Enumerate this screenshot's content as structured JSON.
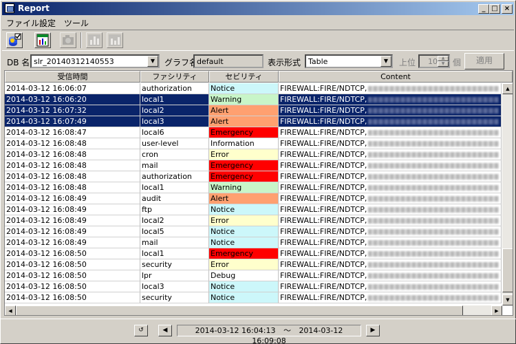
{
  "window": {
    "title": "Report"
  },
  "menu": {
    "file": "ファイル",
    "settings": "設定",
    "tools": "ツール"
  },
  "toolbar": {
    "icons": [
      "db-select-icon",
      "report-icon",
      "camera-icon",
      "bar-chart-icon",
      "chart-icon"
    ]
  },
  "options": {
    "db_label": "DB 名",
    "db_value": "slr_20140312140553",
    "graph_label": "グラフ名",
    "graph_value": "default",
    "display_label": "表示形式",
    "display_value": "Table",
    "top_label": "上位",
    "top_value": "10",
    "top_unit": "個",
    "apply_label": "適用"
  },
  "grid": {
    "headers": [
      "受信時間",
      "ファシリティ",
      "セビリティ",
      "Content"
    ],
    "rows": [
      {
        "time": "2014-03-12 16:06:07",
        "facility": "authorization",
        "severity": "Notice",
        "content": "FIREWALL:FIRE/NDTCP,",
        "selected": false
      },
      {
        "time": "2014-03-12 16:06:20",
        "facility": "local1",
        "severity": "Warning",
        "content": "FIREWALL:FIRE/NDTCP,",
        "selected": true
      },
      {
        "time": "2014-03-12 16:07:32",
        "facility": "local2",
        "severity": "Alert",
        "content": "FIREWALL:FIRE/NDTCP,",
        "selected": true
      },
      {
        "time": "2014-03-12 16:07:49",
        "facility": "local3",
        "severity": "Alert",
        "content": "FIREWALL:FIRE/NDTCP,",
        "selected": true
      },
      {
        "time": "2014-03-12 16:08:47",
        "facility": "local6",
        "severity": "Emergency",
        "content": "FIREWALL:FIRE/NDTCP,",
        "selected": false
      },
      {
        "time": "2014-03-12 16:08:48",
        "facility": "user-level",
        "severity": "Information",
        "content": "FIREWALL:FIRE/NDTCP,",
        "selected": false
      },
      {
        "time": "2014-03-12 16:08:48",
        "facility": "cron",
        "severity": "Error",
        "content": "FIREWALL:FIRE/NDTCP,",
        "selected": false
      },
      {
        "time": "2014-03-12 16:08:48",
        "facility": "mail",
        "severity": "Emergency",
        "content": "FIREWALL:FIRE/NDTCP,",
        "selected": false
      },
      {
        "time": "2014-03-12 16:08:48",
        "facility": "authorization",
        "severity": "Emergency",
        "content": "FIREWALL:FIRE/NDTCP,",
        "selected": false
      },
      {
        "time": "2014-03-12 16:08:48",
        "facility": "local1",
        "severity": "Warning",
        "content": "FIREWALL:FIRE/NDTCP,",
        "selected": false
      },
      {
        "time": "2014-03-12 16:08:49",
        "facility": "audit",
        "severity": "Alert",
        "content": "FIREWALL:FIRE/NDTCP,",
        "selected": false
      },
      {
        "time": "2014-03-12 16:08:49",
        "facility": "ftp",
        "severity": "Notice",
        "content": "FIREWALL:FIRE/NDTCP,",
        "selected": false
      },
      {
        "time": "2014-03-12 16:08:49",
        "facility": "local2",
        "severity": "Error",
        "content": "FIREWALL:FIRE/NDTCP,",
        "selected": false
      },
      {
        "time": "2014-03-12 16:08:49",
        "facility": "local5",
        "severity": "Notice",
        "content": "FIREWALL:FIRE/NDTCP,",
        "selected": false
      },
      {
        "time": "2014-03-12 16:08:49",
        "facility": "mail",
        "severity": "Notice",
        "content": "FIREWALL:FIRE/NDTCP,",
        "selected": false
      },
      {
        "time": "2014-03-12 16:08:50",
        "facility": "local1",
        "severity": "Emergency",
        "content": "FIREWALL:FIRE/NDTCP,",
        "selected": false
      },
      {
        "time": "2014-03-12 16:08:50",
        "facility": "security",
        "severity": "Error",
        "content": "FIREWALL:FIRE/NDTCP,",
        "selected": false
      },
      {
        "time": "2014-03-12 16:08:50",
        "facility": "lpr",
        "severity": "Debug",
        "content": "FIREWALL:FIRE/NDTCP,",
        "selected": false
      },
      {
        "time": "2014-03-12 16:08:50",
        "facility": "local3",
        "severity": "Notice",
        "content": "FIREWALL:FIRE/NDTCP,",
        "selected": false
      },
      {
        "time": "2014-03-12 16:08:50",
        "facility": "security",
        "severity": "Notice",
        "content": "FIREWALL:FIRE/NDTCP,",
        "selected": false
      }
    ]
  },
  "severity_colors": {
    "Notice": "#ccf7fa",
    "Warning": "#c8f5c8",
    "Alert": "#ffa070",
    "Emergency": "#ff0000",
    "Information": "#ffffff",
    "Error": "#ffffcc",
    "Debug": "#ffffff",
    "Critical": "#ffc0c0"
  },
  "selection_color": "#0a246a",
  "nav": {
    "start": "2014-03-12 16:04:13",
    "sep": "〜",
    "end": "2014-03-12 16:09:08"
  }
}
